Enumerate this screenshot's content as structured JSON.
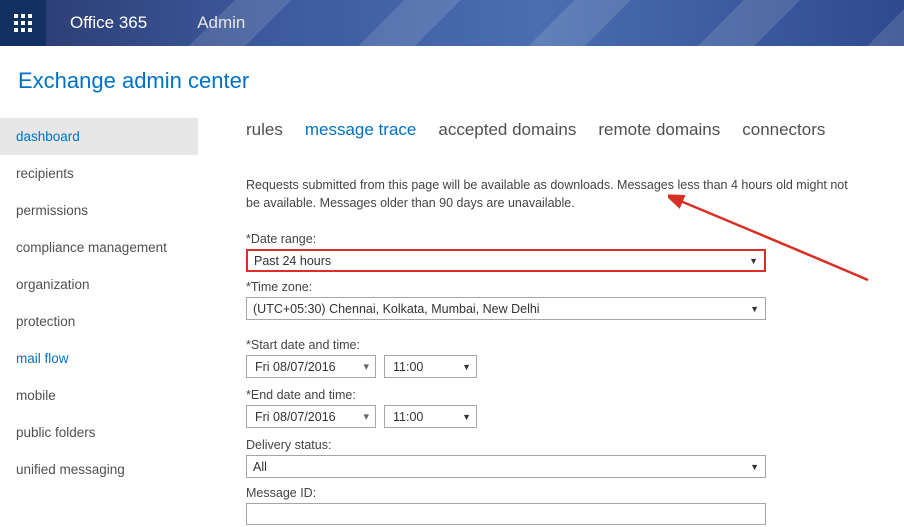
{
  "topbar": {
    "brand": "Office 365",
    "section": "Admin"
  },
  "page_title": "Exchange admin center",
  "sidebar": {
    "items": [
      {
        "label": "dashboard"
      },
      {
        "label": "recipients"
      },
      {
        "label": "permissions"
      },
      {
        "label": "compliance management"
      },
      {
        "label": "organization"
      },
      {
        "label": "protection"
      },
      {
        "label": "mail flow"
      },
      {
        "label": "mobile"
      },
      {
        "label": "public folders"
      },
      {
        "label": "unified messaging"
      }
    ]
  },
  "tabs": [
    {
      "label": "rules"
    },
    {
      "label": "message trace"
    },
    {
      "label": "accepted domains"
    },
    {
      "label": "remote domains"
    },
    {
      "label": "connectors"
    }
  ],
  "intro_text": "Requests submitted from this page will be available as downloads. Messages less than 4 hours old might not be available. Messages older than 90 days are unavailable.",
  "form": {
    "date_range_label": "*Date range:",
    "date_range_value": "Past 24 hours",
    "timezone_label": "*Time zone:",
    "timezone_value": "(UTC+05:30) Chennai, Kolkata, Mumbai, New Delhi",
    "start_label": "*Start date and time:",
    "start_date": "Fri 08/07/2016",
    "start_time": "11:00",
    "end_label": "*End date and time:",
    "end_date": "Fri 08/07/2016",
    "end_time": "11:00",
    "delivery_status_label": "Delivery status:",
    "delivery_status_value": "All",
    "message_id_label": "Message ID:",
    "message_id_value": ""
  }
}
